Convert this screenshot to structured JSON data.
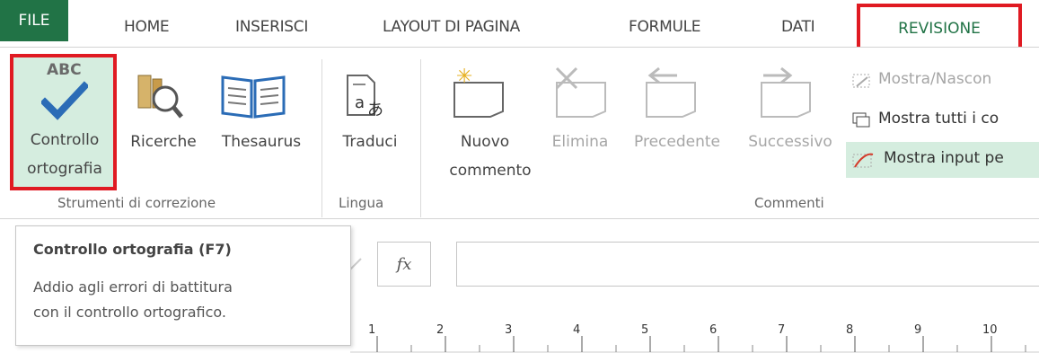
{
  "tabs": {
    "file": "FILE",
    "home": "HOME",
    "insert": "INSERISCI",
    "layout": "LAYOUT DI PAGINA",
    "formulas": "FORMULE",
    "data": "DATI",
    "review": "REVISIONE"
  },
  "groups": {
    "proofing": "Strumenti di correzione",
    "language": "Lingua",
    "comments": "Commenti"
  },
  "buttons": {
    "spell_line1": "Controllo",
    "spell_line2": "ortografia",
    "spell_icon_text": "ABC",
    "research": "Ricerche",
    "thesaurus": "Thesaurus",
    "translate": "Traduci",
    "new_comment_line1": "Nuovo",
    "new_comment_line2": "commento",
    "delete": "Elimina",
    "previous": "Precedente",
    "next": "Successivo",
    "show_hide": "Mostra/Nascon",
    "show_all": "Mostra tutti i co",
    "show_ink": "Mostra input pe"
  },
  "tooltip": {
    "title": "Controllo ortografia (F7)",
    "line1": "Addio agli errori di battitura",
    "line2": "con il controllo ortografico."
  },
  "formula_bar": {
    "fx": "fx",
    "value": ""
  },
  "ruler": [
    "1",
    "2",
    "3",
    "4",
    "5",
    "6",
    "7",
    "8",
    "9",
    "10"
  ],
  "colors": {
    "accent": "#217346",
    "highlight": "#e01a22",
    "selected_bg": "#d5eddf"
  }
}
